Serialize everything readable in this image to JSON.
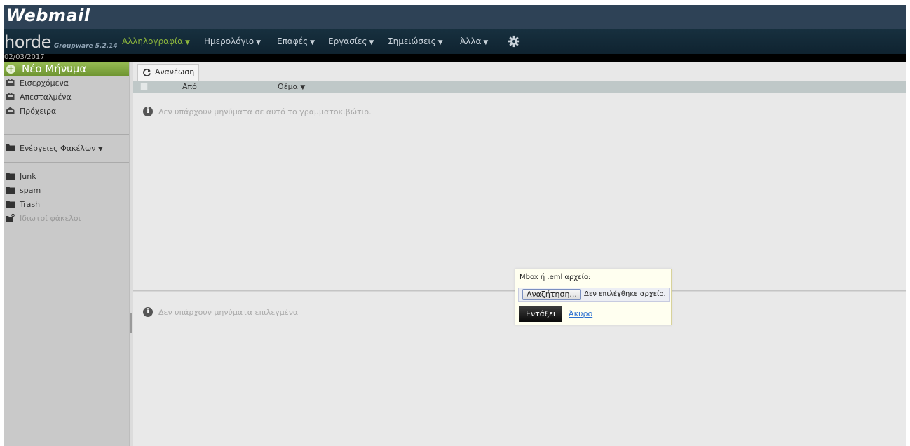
{
  "app": {
    "webmail_logo": "Webmail",
    "horde_logo": "horde",
    "horde_version": "Groupware 5.2.14"
  },
  "menu": {
    "items": [
      {
        "label": "Αλληλογραφία",
        "active": true
      },
      {
        "label": "Ημερολόγιο"
      },
      {
        "label": "Επαφές"
      },
      {
        "label": "Εργασίες"
      },
      {
        "label": "Σημειώσεις"
      },
      {
        "label": "Άλλα"
      }
    ],
    "settings_icon": "gear-icon"
  },
  "date": "02/03/2017",
  "sidebar": {
    "new_message": "Νέο Μήνυμα",
    "folders": [
      {
        "label": "Εισερχόμενα",
        "icon": "inbox-icon"
      },
      {
        "label": "Απεσταλμένα",
        "icon": "sent-icon"
      },
      {
        "label": "Πρόχειρα",
        "icon": "drafts-icon"
      }
    ],
    "folder_actions": "Ενέργειες Φακέλων",
    "other_folders": [
      {
        "label": "Junk",
        "icon": "folder-icon"
      },
      {
        "label": "spam",
        "icon": "folder-icon"
      },
      {
        "label": "Trash",
        "icon": "folder-icon"
      },
      {
        "label": "Ιδιωτοί φάκελοι",
        "icon": "shared-folder-icon"
      }
    ]
  },
  "toolbar": {
    "refresh_label": "Ανανέωση"
  },
  "list": {
    "col_from": "Από",
    "col_subject": "Θέμα",
    "empty_message": "Δεν υπάρχουν μηνύματα σε αυτό το γραμματοκιβώτιο.",
    "preview_message": "Δεν υπάρχουν μηνύματα επιλεγμένα"
  },
  "import_dialog": {
    "label": "Mbox ή .eml αρχείο:",
    "browse_button": "Αναζήτηση...",
    "file_status": "Δεν επιλέχθηκε αρχείο.",
    "import_button": "Εντάξει",
    "cancel_link": "Άκυρο"
  },
  "colors": {
    "header_bg": "#2e4256",
    "menubar_bg": "#17303f",
    "active_menu": "#8bb43c",
    "new_message_green": "#7ea83d",
    "sidebar_bg": "#c9c9c9",
    "dialog_bg": "#fffff0"
  }
}
